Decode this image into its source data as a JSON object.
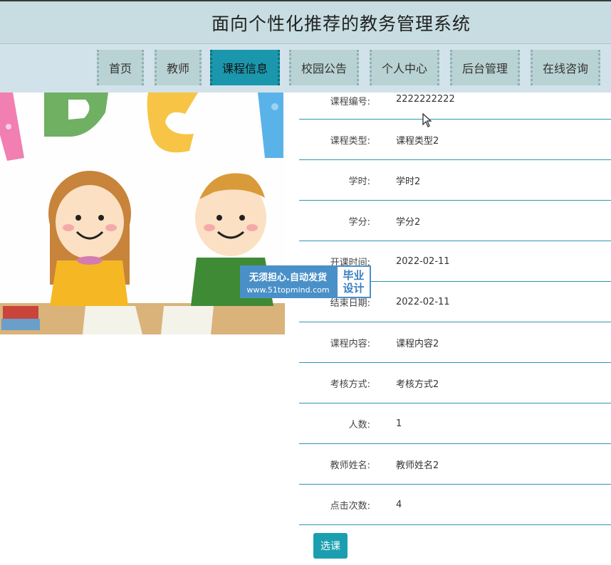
{
  "header": {
    "title": "面向个性化推荐的教务管理系统"
  },
  "nav": {
    "items": [
      {
        "label": "首页",
        "active": false
      },
      {
        "label": "教师",
        "active": false
      },
      {
        "label": "课程信息",
        "active": true
      },
      {
        "label": "校园公告",
        "active": false
      },
      {
        "label": "个人中心",
        "active": false
      },
      {
        "label": "后台管理",
        "active": false
      },
      {
        "label": "在线咨询",
        "active": false
      }
    ]
  },
  "detail": {
    "rows": [
      {
        "label": "课程编号:",
        "value": "2222222222"
      },
      {
        "label": "课程类型:",
        "value": "课程类型2"
      },
      {
        "label": "学时:",
        "value": "学时2"
      },
      {
        "label": "学分:",
        "value": "学分2"
      },
      {
        "label": "开课时间:",
        "value": "2022-02-11"
      },
      {
        "label": "结束日期:",
        "value": "2022-02-11"
      },
      {
        "label": "课程内容:",
        "value": "课程内容2"
      },
      {
        "label": "考核方式:",
        "value": "考核方式2"
      },
      {
        "label": "人数:",
        "value": "1"
      },
      {
        "label": "教师姓名:",
        "value": "教师姓名2"
      },
      {
        "label": "点击次数:",
        "value": "4"
      }
    ],
    "select_label": "选课"
  },
  "watermark": {
    "line1": "无须担心.自动发货",
    "line2": "www.51topmind.com",
    "badge1": "毕业",
    "badge2": "设计"
  },
  "colors": {
    "header_bg": "#c7dde1",
    "nav_bg": "#d2e2ea",
    "nav_item_bg": "#b9d2d3",
    "nav_active_bg": "#1b97ad",
    "row_border": "#2f97b0",
    "button_bg": "#1b9fb0"
  }
}
